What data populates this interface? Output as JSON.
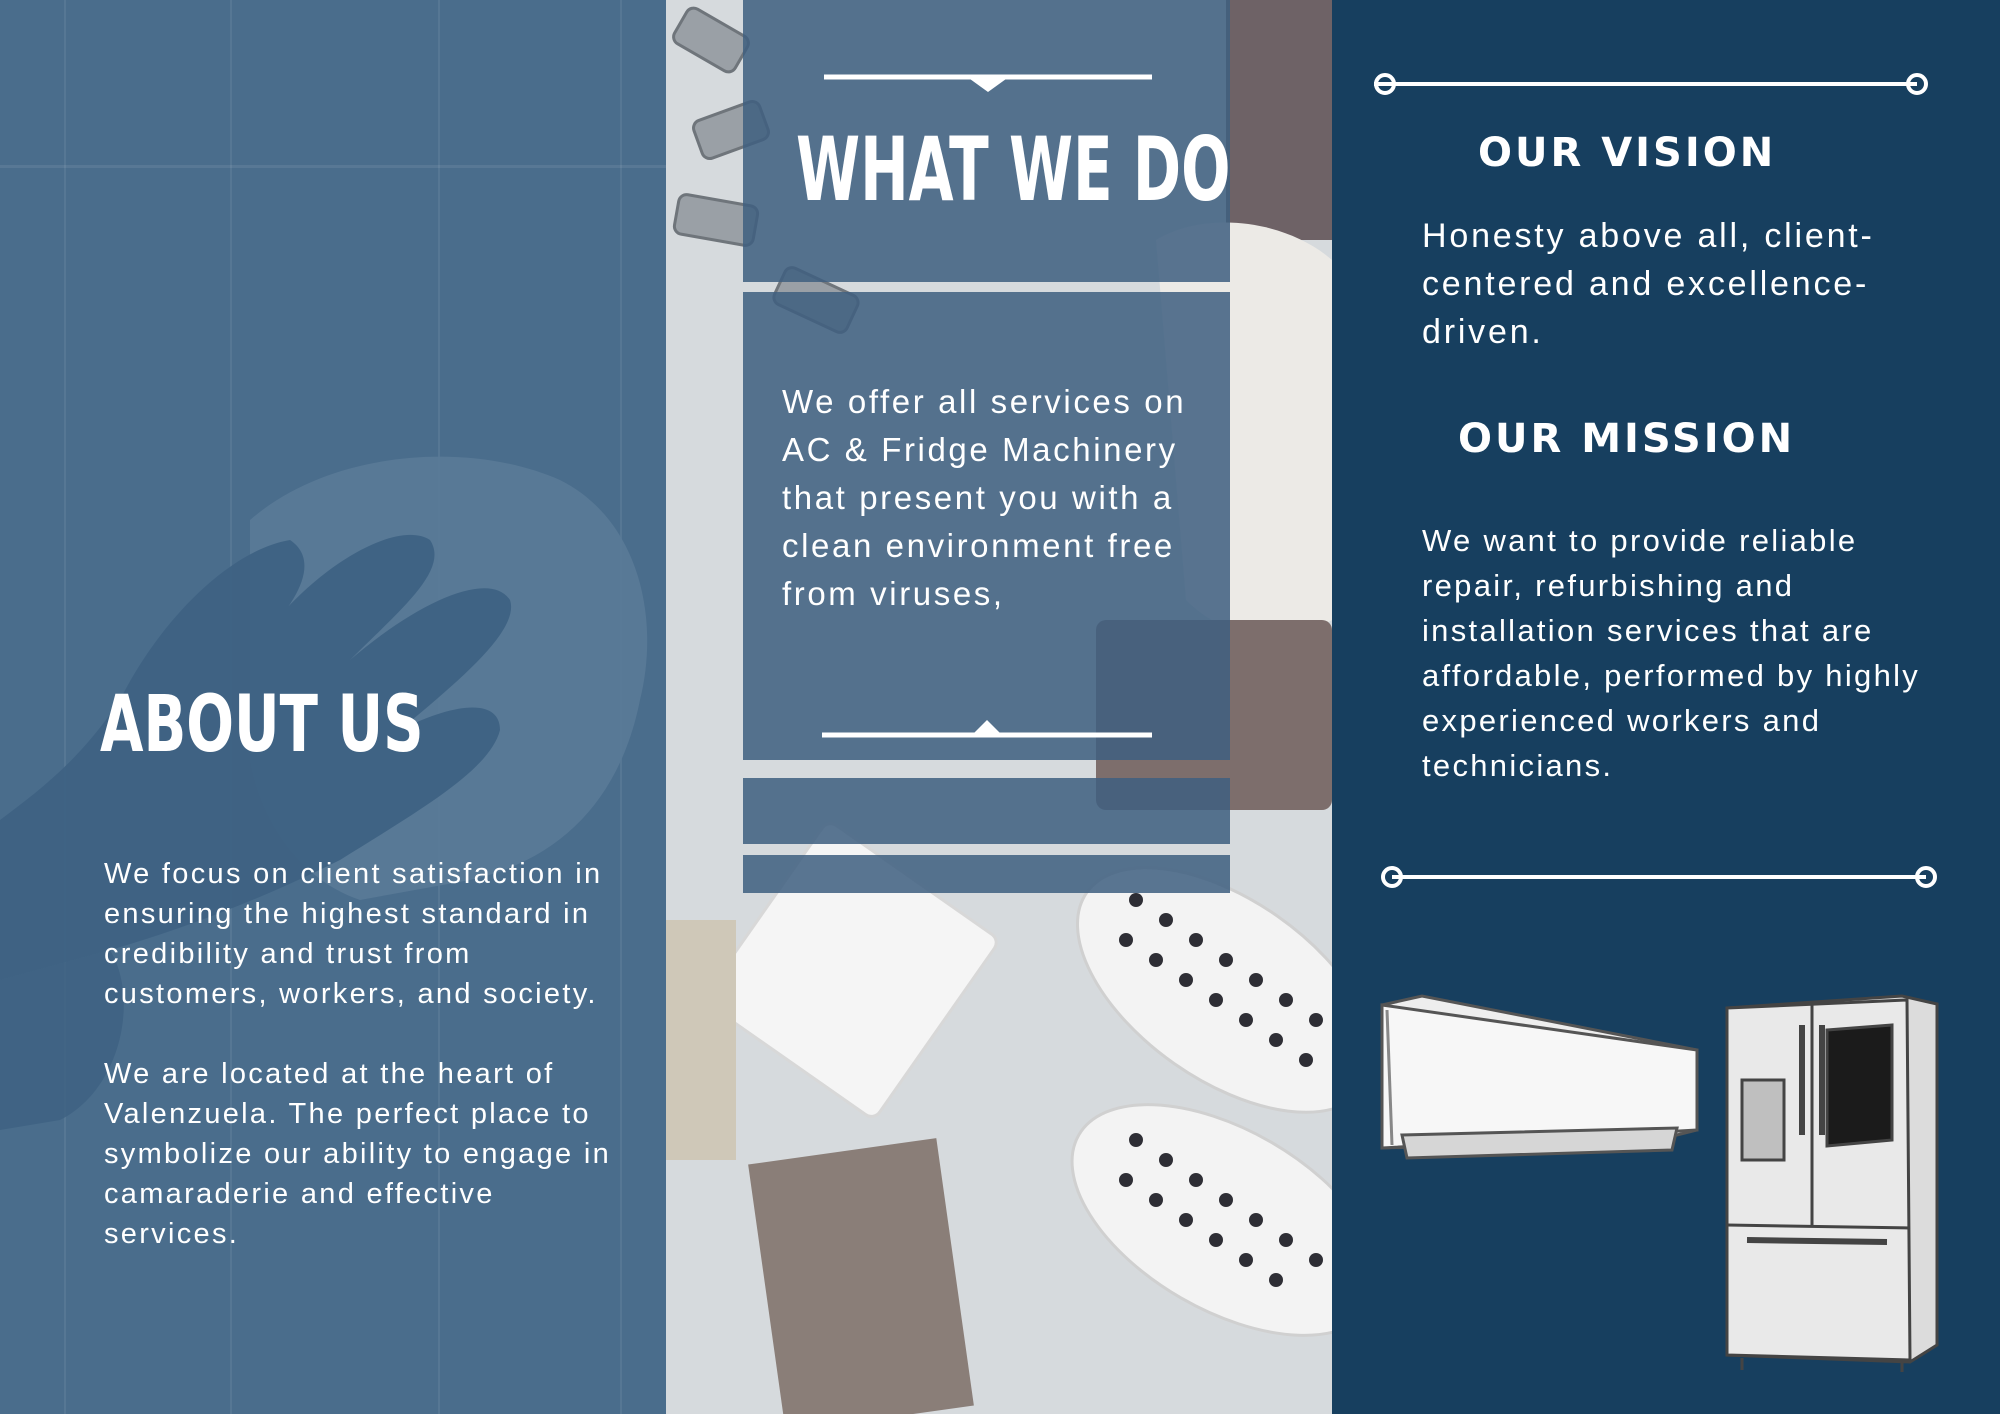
{
  "colors": {
    "left_panel": "#4a6d8c",
    "right_panel": "#173f5f",
    "overlay": "#3f6080",
    "text": "#ffffff"
  },
  "about": {
    "title": "ABOUT US",
    "paragraph_1": "We focus on client satisfaction in ensuring the highest standard in credibility and trust from customers, workers, and society.",
    "paragraph_2": "We are located at the heart of Valenzuela. The perfect place to symbolize our ability to engage in camaraderie and effective services."
  },
  "what_we_do": {
    "title": "WHAT WE DO",
    "text": "We offer all services on AC & Fridge Machinery that present you with a clean environment free from viruses,"
  },
  "vision": {
    "title": "OUR VISION",
    "text": "Honesty above all, client-centered and excellence-driven."
  },
  "mission": {
    "title": "OUR MISSION",
    "text": "We want to provide reliable repair, refurbishing and installation services that are affordable, performed by highly experienced workers and technicians."
  },
  "icons": {
    "air_conditioner": "air-conditioner-icon",
    "refrigerator": "refrigerator-icon"
  }
}
